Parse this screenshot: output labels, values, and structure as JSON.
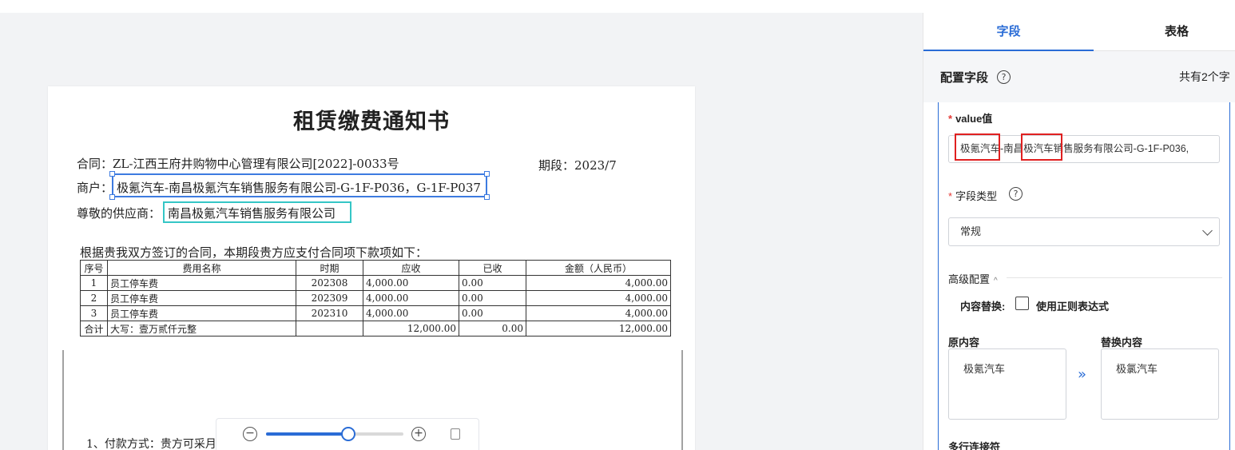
{
  "document": {
    "title": "租赁缴费通知书",
    "contract": "合同：ZL-江西王府井购物中心管理有限公司[2022]-0033号",
    "period": "期段：2023/7",
    "merchant_label": "商户：",
    "merchant_value": "极氪汽车-南昌极氪汽车销售服务有限公司-G-1F-P036，G-1F-P037",
    "supplier_label": "尊敬的供应商：",
    "supplier_value": "南昌极氪汽车销售服务有限公司",
    "intro": "根据贵我双方签订的合同，本期段贵方应支付合同项下款项如下：",
    "table": {
      "headers": [
        "序号",
        "费用名称",
        "时期",
        "应收",
        "已收",
        "金额（人民币）"
      ],
      "rows": [
        [
          "1",
          "员工停车费",
          "202308",
          "4,000.00",
          "0.00",
          "4,000.00"
        ],
        [
          "2",
          "员工停车费",
          "202309",
          "4,000.00",
          "0.00",
          "4,000.00"
        ],
        [
          "3",
          "员工停车费",
          "202310",
          "4,000.00",
          "0.00",
          "4,000.00"
        ]
      ],
      "total": [
        "合计",
        "大写：壹万贰仟元整",
        "",
        "12,000.00",
        "0.00",
        "12,000.00"
      ]
    },
    "footer_partial": "1、付款方式：贵方可采月"
  },
  "zoom": {
    "level": 0.6,
    "minus_icon": "minus-circle-icon",
    "plus_icon": "plus-circle-icon",
    "fit_icon": "fit-page-icon"
  },
  "panel": {
    "tabs": [
      {
        "label": "字段",
        "active": true
      },
      {
        "label": "表格",
        "active": false
      }
    ],
    "config_title": "配置字段",
    "field_count": "共有2个字",
    "value_label": "value值",
    "value_text": "极氪汽车-南昌极汽车销售服务有限公司-G-1F-P036,",
    "field_type_label": "字段类型",
    "field_type_value": "常规",
    "advanced_label": "高级配置",
    "replace_label": "内容替换:",
    "regex_label": "使用正则表达式",
    "original_label": "原内容",
    "original_value": "极氪汽车",
    "replacement_label": "替换内容",
    "replacement_value": "极氯汽车",
    "multiline_label": "多行连接符"
  },
  "colors": {
    "accent": "#2a6cd6",
    "required": "#e53935",
    "highlight_box": "#e02020",
    "selection_box": "#3d7be0",
    "supplier_box": "#35c6c6"
  }
}
